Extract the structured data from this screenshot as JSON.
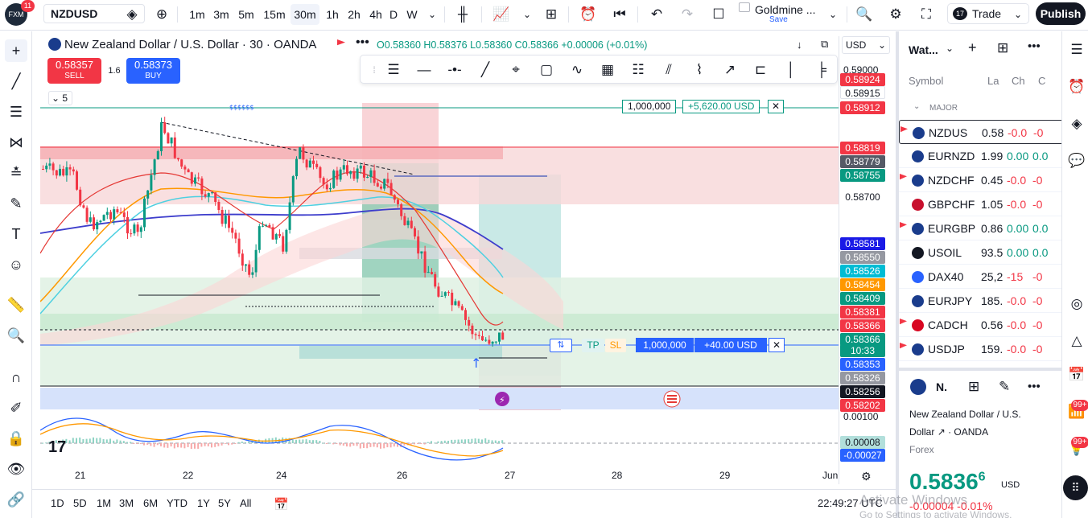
{
  "topbar": {
    "notif_count": "11",
    "symbol": "NZDUSD",
    "timeframes": [
      "1m",
      "3m",
      "5m",
      "15m",
      "30m",
      "1h",
      "2h",
      "4h",
      "D",
      "W"
    ],
    "active_timeframe": "30m",
    "layout_name": "Goldmine ...",
    "layout_save": "Save",
    "trade_label": "Trade",
    "publish_label": "Publish"
  },
  "legend": {
    "title": "New Zealand Dollar / U.S. Dollar · 30 · OANDA",
    "ohlc": "O0.58360 H0.58376 L0.58360 C0.58366 +0.00006 (+0.01%)",
    "sell_price": "0.58357",
    "sell_label": "SELL",
    "spread": "1.6",
    "buy_price": "0.58373",
    "buy_label": "BUY",
    "indicator_count": "5",
    "currency": "USD"
  },
  "positions": {
    "top_qty": "1,000,000",
    "top_pnl": "+5,620.00 USD",
    "bottom_qty": "1,000,000",
    "bottom_pnl": "+40.00 USD",
    "tp_label": "TP",
    "sl_label": "SL",
    "close": "✕"
  },
  "price_scale": {
    "top": "0.59000",
    "labels": [
      {
        "v": "0.58924",
        "c": "#f23645"
      },
      {
        "v": "0.58915",
        "c": "#fff",
        "t": "#131722"
      },
      {
        "v": "0.58912",
        "c": "#f23645"
      },
      {
        "v": "0.58819",
        "c": "#f23645"
      },
      {
        "v": "0.58779",
        "c": "#555a66"
      },
      {
        "v": "0.58755",
        "c": "#089981"
      },
      {
        "v": "0.58700",
        "c": "none",
        "t": "#131722"
      },
      {
        "v": "0.58581",
        "c": "#1a1ae6"
      },
      {
        "v": "0.58550",
        "c": "#9598a1"
      },
      {
        "v": "0.58526",
        "c": "#00bcd4"
      },
      {
        "v": "0.58454",
        "c": "#ff9800"
      },
      {
        "v": "0.58409",
        "c": "#089981"
      },
      {
        "v": "0.58381",
        "c": "#f23645"
      },
      {
        "v": "0.58366",
        "c": "#f23645"
      },
      {
        "v": "0.58366",
        "c": "#089981"
      },
      {
        "v": "10:33",
        "c": "#089981"
      },
      {
        "v": "0.58353",
        "c": "#2962ff"
      },
      {
        "v": "0.58326",
        "c": "#9598a1"
      },
      {
        "v": "0.58256",
        "c": "#131722"
      },
      {
        "v": "0.58202",
        "c": "#f23645"
      }
    ],
    "macd_top": "0.00100",
    "macd_val1": "0.00008",
    "macd_val2": "-0.00027"
  },
  "x_axis": [
    "21",
    "22",
    "24",
    "26",
    "27",
    "28",
    "29",
    "Jun"
  ],
  "ranges": [
    "1D",
    "5D",
    "1M",
    "3M",
    "6M",
    "YTD",
    "1Y",
    "5Y",
    "All"
  ],
  "clock": "22:49:27 UTC",
  "watchlist": {
    "title": "Wat...",
    "col_symbol": "Symbol",
    "col_last": "La",
    "col_chg": "Ch",
    "col_chgp": "C",
    "section": "MAJOR",
    "rows": [
      {
        "sym": "NZDUS",
        "last": "0.58",
        "ch": "-0.0",
        "chp": "-0",
        "color": "#f23645",
        "flag": "#1a3c8c"
      },
      {
        "sym": "EURNZD",
        "last": "1.99",
        "ch": "0.00",
        "chp": "0.0",
        "color": "#089981",
        "flag": "#1a3c8c"
      },
      {
        "sym": "NZDCHF",
        "last": "0.45",
        "ch": "-0.0",
        "chp": "-0",
        "color": "#f23645",
        "flag": "#1a3c8c"
      },
      {
        "sym": "GBPCHF",
        "last": "1.05",
        "ch": "-0.0",
        "chp": "-0",
        "color": "#f23645",
        "flag": "#c8102e"
      },
      {
        "sym": "EURGBP",
        "last": "0.86",
        "ch": "0.00",
        "chp": "0.0",
        "color": "#089981",
        "flag": "#1a3c8c"
      },
      {
        "sym": "USOIL",
        "last": "93.5",
        "ch": "0.00",
        "chp": "0.0",
        "color": "#089981",
        "flag": "#131722"
      },
      {
        "sym": "DAX40",
        "last": "25,2",
        "ch": "-15",
        "chp": "-0",
        "color": "#f23645",
        "flag": "#2962ff"
      },
      {
        "sym": "EURJPY",
        "last": "185.",
        "ch": "-0.0",
        "chp": "-0",
        "color": "#f23645",
        "flag": "#1a3c8c"
      },
      {
        "sym": "CADCH",
        "last": "0.56",
        "ch": "-0.0",
        "chp": "-0",
        "color": "#f23645",
        "flag": "#d80621"
      },
      {
        "sym": "USDJP",
        "last": "159.",
        "ch": "-0.0",
        "chp": "-0",
        "color": "#f23645",
        "flag": "#1a3c8c"
      }
    ],
    "detail_sym": "N.",
    "detail_name1": "New Zealand Dollar / U.S.",
    "detail_name2": "Dollar",
    "detail_exchange": "· OANDA",
    "detail_type": "Forex",
    "detail_price": "0.5836",
    "detail_price_sup": "6",
    "detail_currency": "USD",
    "detail_change": "-0.00004 -0.01%",
    "watermark1": "Activate Windows",
    "watermark2": "Go to Settings to activate Windows."
  },
  "badges": {
    "b1": "99+",
    "b2": "99+"
  }
}
